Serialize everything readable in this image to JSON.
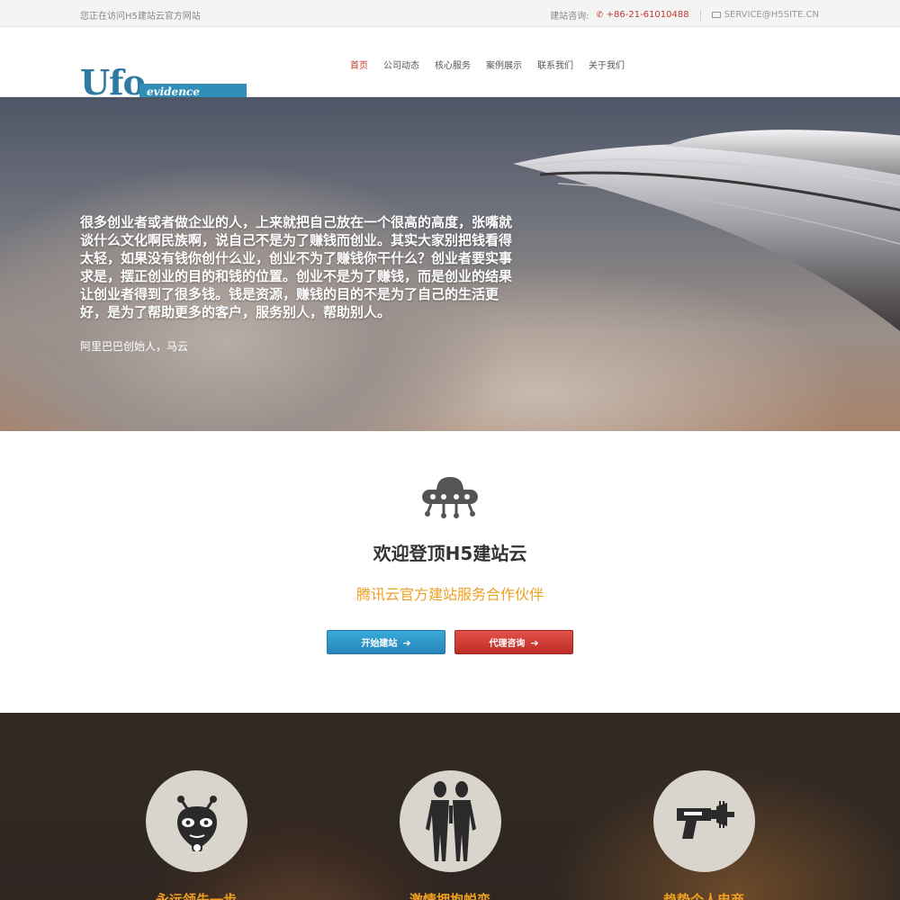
{
  "topbar": {
    "notice": "您正在访问H5建站云官方网站",
    "contact_label": "建站咨询:",
    "phone": "+86-21-61010488",
    "email": "SERVICE@H5SITE.CN"
  },
  "logo": {
    "main": "Ufo",
    "tag": "evidence"
  },
  "nav": [
    {
      "label": "首页",
      "active": true
    },
    {
      "label": "公司动态"
    },
    {
      "label": "核心服务"
    },
    {
      "label": "案例展示"
    },
    {
      "label": "联系我们"
    },
    {
      "label": "关于我们"
    }
  ],
  "hero": {
    "quote": "很多创业者或者做企业的人，上来就把自己放在一个很高的高度，张嘴就谈什么文化啊民族啊，说自己不是为了赚钱而创业。其实大家别把钱看得太轻，如果没有钱你创什么业，创业不为了赚钱你干什么？创业者要实事求是，摆正创业的目的和钱的位置。创业不是为了赚钱，而是创业的结果让创业者得到了很多钱。钱是资源，赚钱的目的不是为了自己的生活更好，是为了帮助更多的客户，服务别人，帮助别人。",
    "author": "阿里巴巴创始人，马云"
  },
  "welcome": {
    "title": "欢迎登顶H5建站云",
    "subtitle": "腾讯云官方建站服务合作伙伴",
    "btn_start": "开始建站",
    "btn_agent": "代理咨询"
  },
  "features": [
    {
      "title": "永远领先一步",
      "icon": "alien-head-icon"
    },
    {
      "title": "激情拥抱蜕变",
      "icon": "aliens-icon"
    },
    {
      "title": "趋势个人电商",
      "icon": "ray-gun-icon"
    }
  ],
  "colors": {
    "brand": "#2f7aa3",
    "accent": "#f0a020",
    "red": "#c0392b"
  }
}
